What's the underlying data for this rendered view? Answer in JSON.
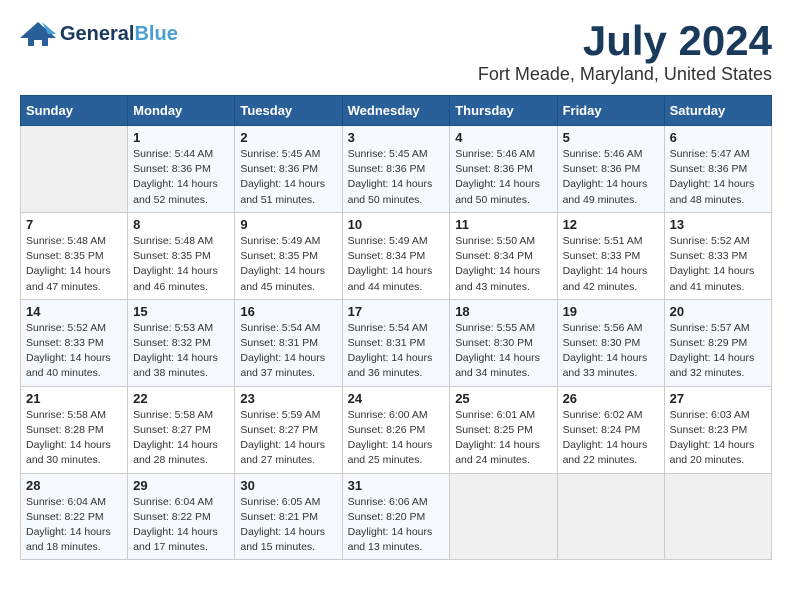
{
  "header": {
    "logo": {
      "general": "General",
      "blue": "Blue",
      "url_text": "GeneralBlue"
    },
    "title": "July 2024",
    "subtitle": "Fort Meade, Maryland, United States"
  },
  "days_of_week": [
    "Sunday",
    "Monday",
    "Tuesday",
    "Wednesday",
    "Thursday",
    "Friday",
    "Saturday"
  ],
  "weeks": [
    {
      "days": [
        {
          "num": "",
          "info": ""
        },
        {
          "num": "1",
          "info": "Sunrise: 5:44 AM\nSunset: 8:36 PM\nDaylight: 14 hours\nand 52 minutes."
        },
        {
          "num": "2",
          "info": "Sunrise: 5:45 AM\nSunset: 8:36 PM\nDaylight: 14 hours\nand 51 minutes."
        },
        {
          "num": "3",
          "info": "Sunrise: 5:45 AM\nSunset: 8:36 PM\nDaylight: 14 hours\nand 50 minutes."
        },
        {
          "num": "4",
          "info": "Sunrise: 5:46 AM\nSunset: 8:36 PM\nDaylight: 14 hours\nand 50 minutes."
        },
        {
          "num": "5",
          "info": "Sunrise: 5:46 AM\nSunset: 8:36 PM\nDaylight: 14 hours\nand 49 minutes."
        },
        {
          "num": "6",
          "info": "Sunrise: 5:47 AM\nSunset: 8:36 PM\nDaylight: 14 hours\nand 48 minutes."
        }
      ]
    },
    {
      "days": [
        {
          "num": "7",
          "info": "Sunrise: 5:48 AM\nSunset: 8:35 PM\nDaylight: 14 hours\nand 47 minutes."
        },
        {
          "num": "8",
          "info": "Sunrise: 5:48 AM\nSunset: 8:35 PM\nDaylight: 14 hours\nand 46 minutes."
        },
        {
          "num": "9",
          "info": "Sunrise: 5:49 AM\nSunset: 8:35 PM\nDaylight: 14 hours\nand 45 minutes."
        },
        {
          "num": "10",
          "info": "Sunrise: 5:49 AM\nSunset: 8:34 PM\nDaylight: 14 hours\nand 44 minutes."
        },
        {
          "num": "11",
          "info": "Sunrise: 5:50 AM\nSunset: 8:34 PM\nDaylight: 14 hours\nand 43 minutes."
        },
        {
          "num": "12",
          "info": "Sunrise: 5:51 AM\nSunset: 8:33 PM\nDaylight: 14 hours\nand 42 minutes."
        },
        {
          "num": "13",
          "info": "Sunrise: 5:52 AM\nSunset: 8:33 PM\nDaylight: 14 hours\nand 41 minutes."
        }
      ]
    },
    {
      "days": [
        {
          "num": "14",
          "info": "Sunrise: 5:52 AM\nSunset: 8:33 PM\nDaylight: 14 hours\nand 40 minutes."
        },
        {
          "num": "15",
          "info": "Sunrise: 5:53 AM\nSunset: 8:32 PM\nDaylight: 14 hours\nand 38 minutes."
        },
        {
          "num": "16",
          "info": "Sunrise: 5:54 AM\nSunset: 8:31 PM\nDaylight: 14 hours\nand 37 minutes."
        },
        {
          "num": "17",
          "info": "Sunrise: 5:54 AM\nSunset: 8:31 PM\nDaylight: 14 hours\nand 36 minutes."
        },
        {
          "num": "18",
          "info": "Sunrise: 5:55 AM\nSunset: 8:30 PM\nDaylight: 14 hours\nand 34 minutes."
        },
        {
          "num": "19",
          "info": "Sunrise: 5:56 AM\nSunset: 8:30 PM\nDaylight: 14 hours\nand 33 minutes."
        },
        {
          "num": "20",
          "info": "Sunrise: 5:57 AM\nSunset: 8:29 PM\nDaylight: 14 hours\nand 32 minutes."
        }
      ]
    },
    {
      "days": [
        {
          "num": "21",
          "info": "Sunrise: 5:58 AM\nSunset: 8:28 PM\nDaylight: 14 hours\nand 30 minutes."
        },
        {
          "num": "22",
          "info": "Sunrise: 5:58 AM\nSunset: 8:27 PM\nDaylight: 14 hours\nand 28 minutes."
        },
        {
          "num": "23",
          "info": "Sunrise: 5:59 AM\nSunset: 8:27 PM\nDaylight: 14 hours\nand 27 minutes."
        },
        {
          "num": "24",
          "info": "Sunrise: 6:00 AM\nSunset: 8:26 PM\nDaylight: 14 hours\nand 25 minutes."
        },
        {
          "num": "25",
          "info": "Sunrise: 6:01 AM\nSunset: 8:25 PM\nDaylight: 14 hours\nand 24 minutes."
        },
        {
          "num": "26",
          "info": "Sunrise: 6:02 AM\nSunset: 8:24 PM\nDaylight: 14 hours\nand 22 minutes."
        },
        {
          "num": "27",
          "info": "Sunrise: 6:03 AM\nSunset: 8:23 PM\nDaylight: 14 hours\nand 20 minutes."
        }
      ]
    },
    {
      "days": [
        {
          "num": "28",
          "info": "Sunrise: 6:04 AM\nSunset: 8:22 PM\nDaylight: 14 hours\nand 18 minutes."
        },
        {
          "num": "29",
          "info": "Sunrise: 6:04 AM\nSunset: 8:22 PM\nDaylight: 14 hours\nand 17 minutes."
        },
        {
          "num": "30",
          "info": "Sunrise: 6:05 AM\nSunset: 8:21 PM\nDaylight: 14 hours\nand 15 minutes."
        },
        {
          "num": "31",
          "info": "Sunrise: 6:06 AM\nSunset: 8:20 PM\nDaylight: 14 hours\nand 13 minutes."
        },
        {
          "num": "",
          "info": ""
        },
        {
          "num": "",
          "info": ""
        },
        {
          "num": "",
          "info": ""
        }
      ]
    }
  ]
}
